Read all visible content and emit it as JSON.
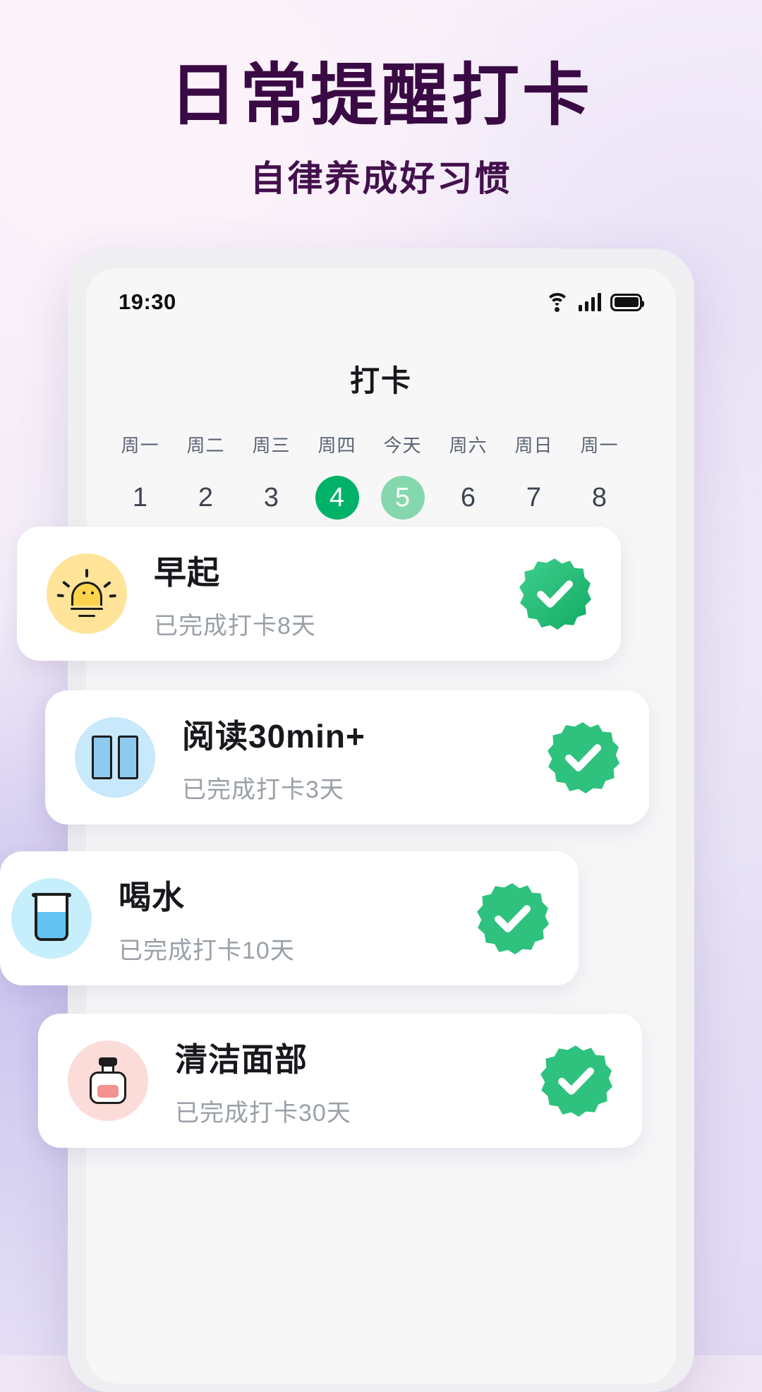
{
  "promo": {
    "title": "日常提醒打卡",
    "subtitle": "自律养成好习惯",
    "title_color": "#3a0a44"
  },
  "phone": {
    "status_bar": {
      "time": "19:30",
      "icons": [
        "wifi-icon",
        "cellular-signal-icon",
        "battery-icon"
      ],
      "signal_bars": 4,
      "battery_full": true
    },
    "app": {
      "title": "打卡",
      "accent_color": "#00b268",
      "today_color": "#85d8ad",
      "calendar": {
        "days": [
          {
            "name": "周一",
            "num": "1",
            "state": "normal"
          },
          {
            "name": "周二",
            "num": "2",
            "state": "normal"
          },
          {
            "name": "周三",
            "num": "3",
            "state": "normal"
          },
          {
            "name": "周四",
            "num": "4",
            "state": "selected"
          },
          {
            "name": "今天",
            "num": "5",
            "state": "today"
          },
          {
            "name": "周六",
            "num": "6",
            "state": "normal"
          },
          {
            "name": "周日",
            "num": "7",
            "state": "normal"
          },
          {
            "name": "周一",
            "num": "8",
            "state": "normal"
          }
        ]
      },
      "habits": [
        {
          "title": "早起",
          "subtitle": "已完成打卡8天",
          "icon": "sunrise-icon",
          "icon_bg": "#ffe49a",
          "checked": true
        },
        {
          "title": "阅读30min+",
          "subtitle": "已完成打卡3天",
          "icon": "open-book-icon",
          "icon_bg": "#c8e8fb",
          "checked": true
        },
        {
          "title": "喝水",
          "subtitle": "已完成打卡10天",
          "icon": "water-glass-icon",
          "icon_bg": "#c6eefb",
          "checked": true
        },
        {
          "title": "清洁面部",
          "subtitle": "已完成打卡30天",
          "icon": "cleanser-bottle-icon",
          "icon_bg": "#fbdcd9",
          "checked": true
        }
      ]
    }
  }
}
